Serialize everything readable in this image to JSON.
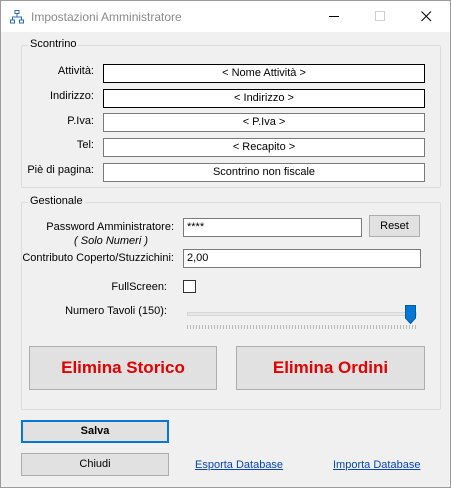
{
  "window": {
    "title": "Impostazioni Amministratore"
  },
  "scontrino": {
    "legend": "Scontrino",
    "fields": [
      {
        "label": "Attività:",
        "value": "< Nome Attività >"
      },
      {
        "label": "Indirizzo:",
        "value": "< Indirizzo >"
      },
      {
        "label": "P.Iva:",
        "value": "< P.Iva >"
      },
      {
        "label": "Tel:",
        "value": "< Recapito >"
      },
      {
        "label": "Piè di pagina:",
        "value": "Scontrino non fiscale"
      }
    ]
  },
  "gestionale": {
    "legend": "Gestionale",
    "password_label": "Password Amministratore:",
    "password_hint": "( Solo Numeri )",
    "password_value": "****",
    "reset_label": "Reset",
    "coperto_label": "Contributo Coperto/Stuzzichini:",
    "coperto_value": "2,00",
    "fullscreen_label": "FullScreen:",
    "fullscreen_checked": false,
    "tavoli_label": "Numero Tavoli (150):",
    "tavoli_value": 150,
    "elimina_storico_label": "Elimina Storico",
    "elimina_ordini_label": "Elimina Ordini",
    "danger_color": "#e00000"
  },
  "footer": {
    "salva_label": "Salva",
    "chiudi_label": "Chiudi",
    "esporta_label": "Esporta Database",
    "importa_label": "Importa Database"
  }
}
